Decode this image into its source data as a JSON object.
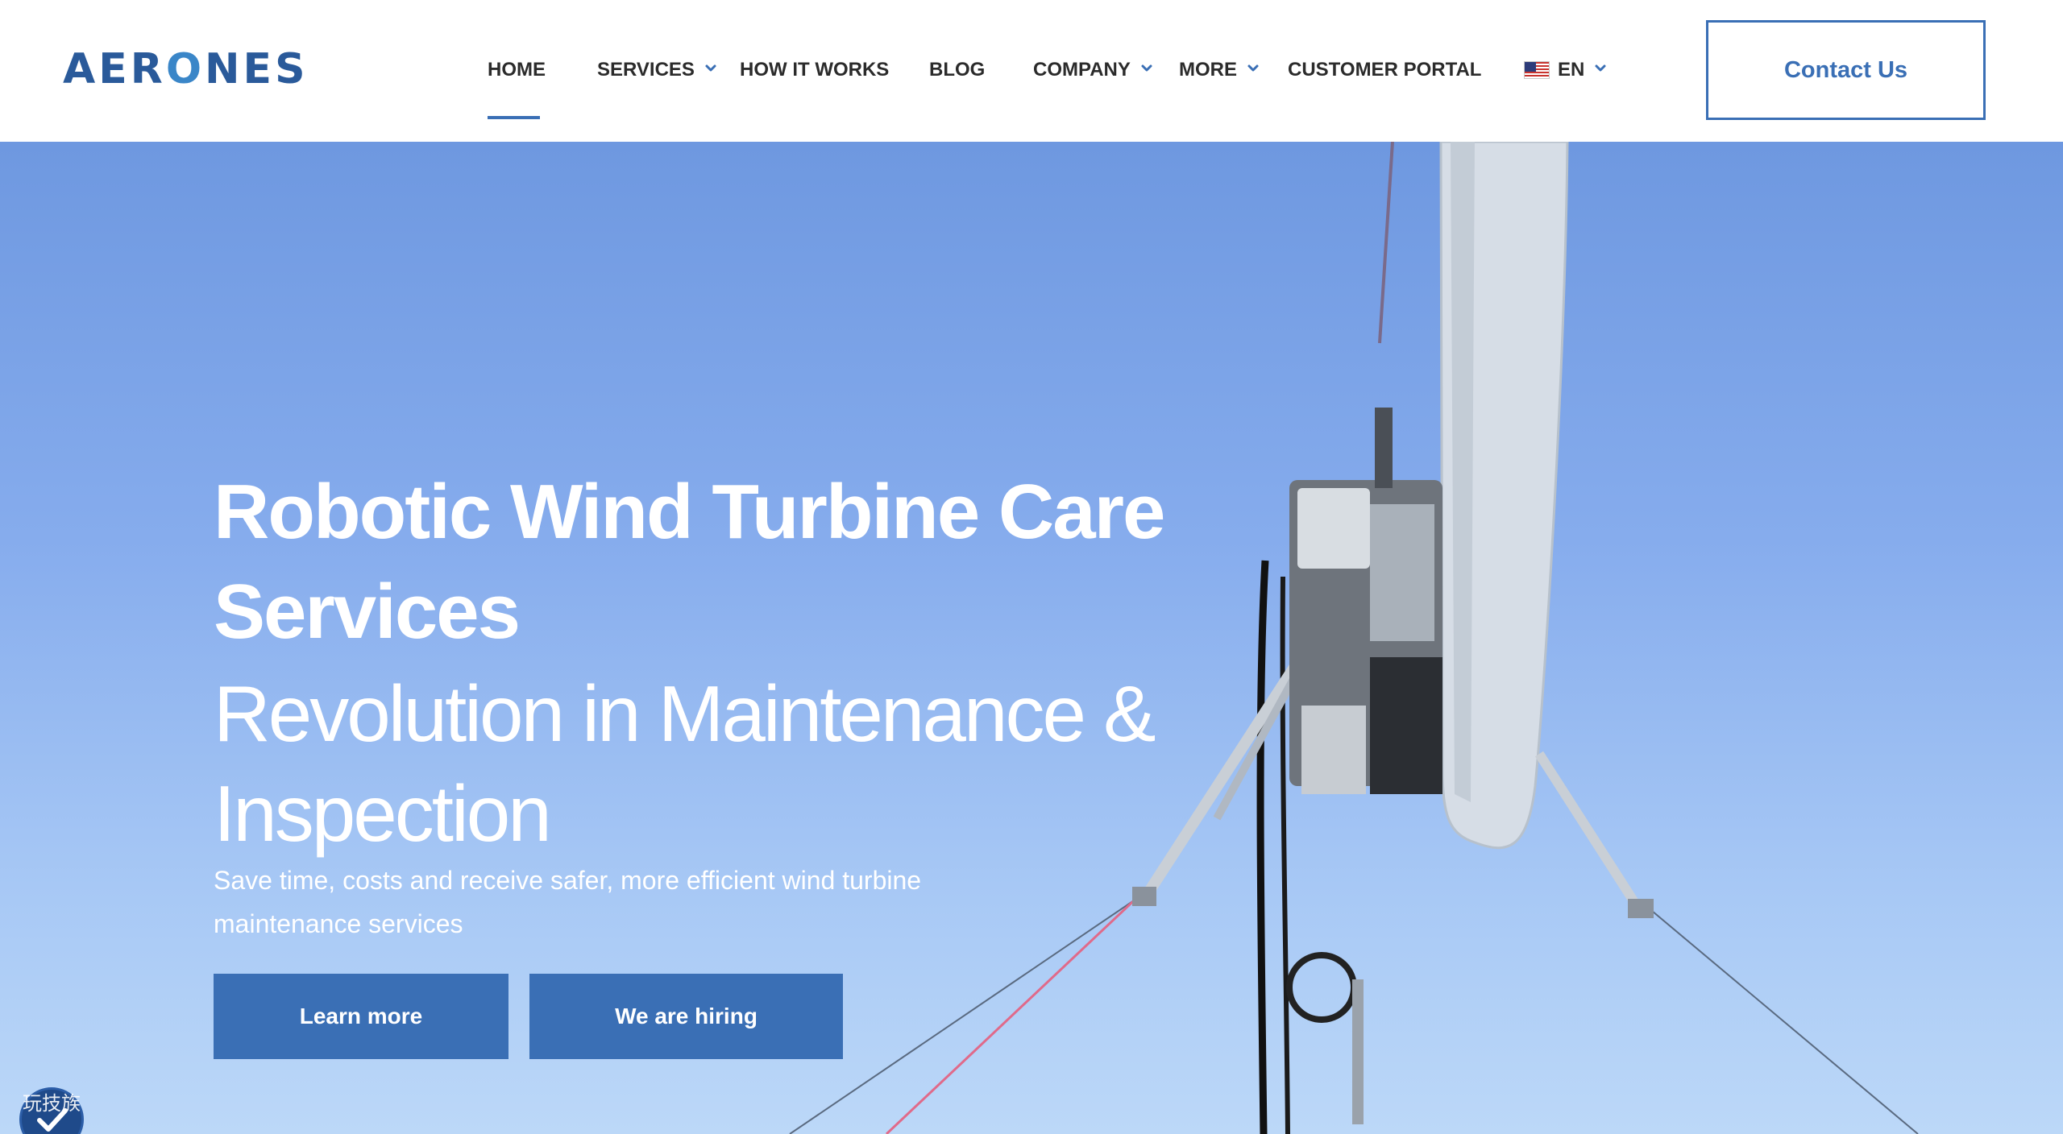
{
  "header": {
    "logo": {
      "text_left": "AER",
      "text_mark": "O",
      "text_right": "NES",
      "icon": "aerones-logo"
    },
    "nav": [
      {
        "label": "HOME",
        "has_dropdown": false,
        "active": true
      },
      {
        "label": "SERVICES",
        "has_dropdown": true
      },
      {
        "label": "HOW IT WORKS",
        "has_dropdown": false
      },
      {
        "label": "BLOG",
        "has_dropdown": false
      },
      {
        "label": "COMPANY",
        "has_dropdown": true
      },
      {
        "label": "MORE",
        "has_dropdown": true
      },
      {
        "label": "CUSTOMER PORTAL",
        "has_dropdown": false
      }
    ],
    "language": {
      "label": "EN",
      "icon": "us-flag-icon"
    },
    "contact_button": "Contact Us"
  },
  "hero": {
    "title": "Robotic Wind Turbine Care Services",
    "subtitle": "Revolution in Maintenance & Inspection",
    "description": "Save time, costs and receive safer, more efficient wind turbine maintenance services",
    "primary_button": "Learn more",
    "secondary_button": "We are hiring"
  },
  "watermark": {
    "text": "玩技族",
    "icon": "shield-check-icon"
  },
  "colors": {
    "brand_blue": "#3a6fb5",
    "logo_blue": "#2a5a9a",
    "nav_text": "#2b2b2b",
    "hero_sky_top": "#6e98e0",
    "hero_sky_bottom": "#bcd8f8"
  }
}
